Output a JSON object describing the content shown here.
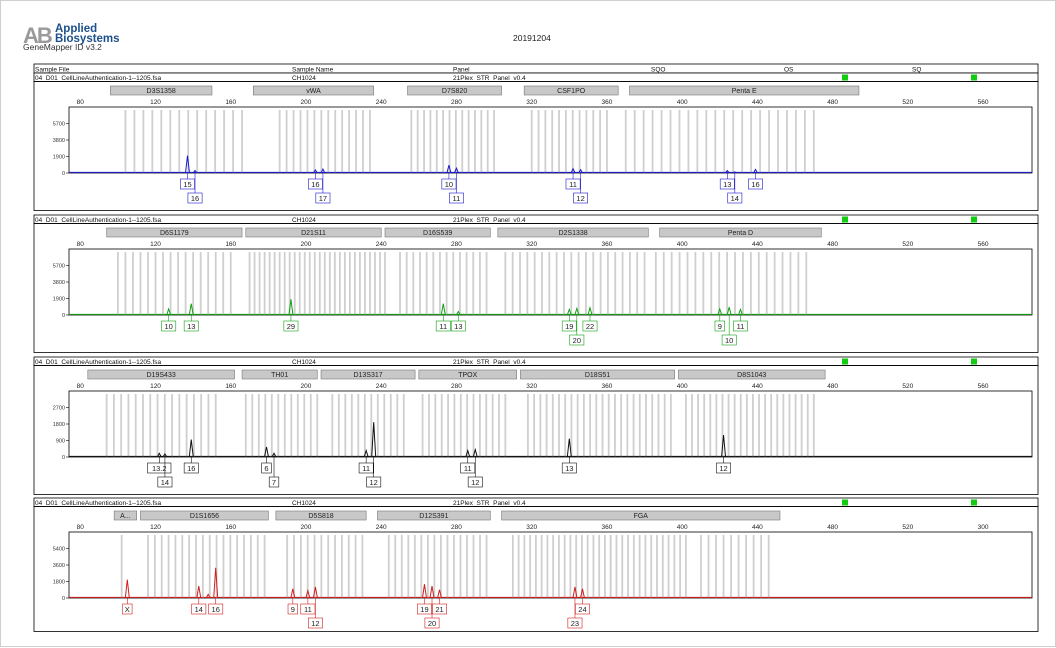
{
  "header": {
    "logo_mark": "AB",
    "logo_line1": "Applied",
    "logo_line2": "Biosystems",
    "software": "GeneMapper ID v3.2",
    "date": "20191204",
    "columns": [
      "Sample File",
      "Sample Name",
      "Panel",
      "SQO",
      "OS",
      "SQ"
    ]
  },
  "chart_data": [
    {
      "type": "line",
      "sample_file": "04_D01_CellLineAuthentication-1--1205.fsa",
      "sample_name": "CH1024",
      "panel": "21Plex_STR_Panel_v0.4",
      "color": "#1a1acc",
      "x_ticks": [
        80,
        120,
        160,
        200,
        240,
        280,
        320,
        360,
        400,
        440,
        480,
        520,
        560
      ],
      "y_ticks": [
        0,
        1900,
        3800,
        5700
      ],
      "y_tick_labels": [
        "0",
        "1900",
        "3800",
        "5700"
      ],
      "ylim": [
        0,
        7600
      ],
      "xlim": [
        74,
        586
      ],
      "markers": [
        {
          "name": "D3S1358",
          "start": 96,
          "end": 150
        },
        {
          "name": "vWA",
          "start": 172,
          "end": 236
        },
        {
          "name": "D7S820",
          "start": 254,
          "end": 304
        },
        {
          "name": "CSF1PO",
          "start": 316,
          "end": 366
        },
        {
          "name": "Penta E",
          "start": 372,
          "end": 494
        }
      ],
      "bins": [
        {
          "start": 104,
          "end": 166,
          "n": 14
        },
        {
          "start": 186,
          "end": 234,
          "n": 14
        },
        {
          "start": 256,
          "end": 300,
          "n": 14
        },
        {
          "start": 320,
          "end": 360,
          "n": 12
        },
        {
          "start": 370,
          "end": 470,
          "n": 22
        }
      ],
      "peaks": [
        {
          "x": 137,
          "h": 2000,
          "label": "15",
          "row": 0
        },
        {
          "x": 141,
          "h": 280,
          "label": "16",
          "row": 1
        },
        {
          "x": 205,
          "h": 350,
          "label": "16",
          "row": 0
        },
        {
          "x": 209,
          "h": 450,
          "label": "17",
          "row": 1
        },
        {
          "x": 276,
          "h": 900,
          "label": "10",
          "row": 0
        },
        {
          "x": 280,
          "h": 550,
          "label": "11",
          "row": 1
        },
        {
          "x": 342,
          "h": 500,
          "label": "11",
          "row": 0
        },
        {
          "x": 346,
          "h": 380,
          "label": "12",
          "row": 1
        },
        {
          "x": 424,
          "h": 280,
          "label": "13",
          "row": 0
        },
        {
          "x": 428,
          "h": 120,
          "label": "14",
          "row": 1
        },
        {
          "x": 439,
          "h": 420,
          "label": "16",
          "row": 0
        }
      ]
    },
    {
      "type": "line",
      "sample_file": "04_D01_CellLineAuthentication-1--1205.fsa",
      "sample_name": "CH1024",
      "panel": "21Plex_STR_Panel_v0.4",
      "color": "#11a011",
      "x_ticks": [
        80,
        120,
        160,
        200,
        240,
        280,
        320,
        360,
        400,
        440,
        480,
        520,
        560
      ],
      "y_ticks": [
        0,
        1900,
        3800,
        5700
      ],
      "y_tick_labels": [
        "0",
        "1900",
        "3800",
        "5700"
      ],
      "ylim": [
        0,
        7600
      ],
      "xlim": [
        74,
        586
      ],
      "markers": [
        {
          "name": "D6S1179",
          "start": 94,
          "end": 166
        },
        {
          "name": "D21S11",
          "start": 168,
          "end": 240
        },
        {
          "name": "D16S539",
          "start": 242,
          "end": 298
        },
        {
          "name": "D2S1338",
          "start": 302,
          "end": 382
        },
        {
          "name": "Penta D",
          "start": 388,
          "end": 474
        }
      ],
      "bins": [
        {
          "start": 100,
          "end": 160,
          "n": 16
        },
        {
          "start": 170,
          "end": 242,
          "n": 28
        },
        {
          "start": 250,
          "end": 296,
          "n": 14
        },
        {
          "start": 306,
          "end": 380,
          "n": 20
        },
        {
          "start": 386,
          "end": 466,
          "n": 20
        }
      ],
      "peaks": [
        {
          "x": 127,
          "h": 700,
          "label": "10",
          "row": 0
        },
        {
          "x": 139,
          "h": 1300,
          "label": "13",
          "row": 0
        },
        {
          "x": 192,
          "h": 1800,
          "label": "29",
          "row": 0
        },
        {
          "x": 273,
          "h": 1300,
          "label": "11",
          "row": 0
        },
        {
          "x": 281,
          "h": 400,
          "label": "13",
          "row": 0
        },
        {
          "x": 340,
          "h": 650,
          "label": "19",
          "row": 0
        },
        {
          "x": 344,
          "h": 750,
          "label": "20",
          "row": 1
        },
        {
          "x": 351,
          "h": 850,
          "label": "22",
          "row": 0
        },
        {
          "x": 420,
          "h": 700,
          "label": "9",
          "row": 0
        },
        {
          "x": 425,
          "h": 900,
          "label": "10",
          "row": 1
        },
        {
          "x": 431,
          "h": 650,
          "label": "11",
          "row": 0
        }
      ]
    },
    {
      "type": "line",
      "sample_file": "04_D01_CellLineAuthentication-1--1205.fsa",
      "sample_name": "CH1024",
      "panel": "21Plex_STR_Panel_v0.4",
      "color": "#111111",
      "x_ticks": [
        80,
        120,
        160,
        200,
        240,
        280,
        320,
        360,
        400,
        440,
        480,
        520,
        560
      ],
      "y_ticks": [
        0,
        900,
        1800,
        2700
      ],
      "y_tick_labels": [
        "0",
        "900",
        "1800",
        "2700"
      ],
      "ylim": [
        0,
        3600
      ],
      "xlim": [
        74,
        586
      ],
      "markers": [
        {
          "name": "D19S433",
          "start": 84,
          "end": 162
        },
        {
          "name": "TH01",
          "start": 166,
          "end": 206
        },
        {
          "name": "D13S317",
          "start": 208,
          "end": 258
        },
        {
          "name": "TPOX",
          "start": 260,
          "end": 312
        },
        {
          "name": "D18S51",
          "start": 314,
          "end": 396
        },
        {
          "name": "D8S1043",
          "start": 398,
          "end": 476
        }
      ],
      "bins": [
        {
          "start": 94,
          "end": 152,
          "n": 16
        },
        {
          "start": 168,
          "end": 206,
          "n": 12
        },
        {
          "start": 214,
          "end": 252,
          "n": 12
        },
        {
          "start": 262,
          "end": 306,
          "n": 14
        },
        {
          "start": 318,
          "end": 394,
          "n": 24
        },
        {
          "start": 402,
          "end": 470,
          "n": 22
        }
      ],
      "peaks": [
        {
          "x": 122,
          "h": 200,
          "label": "13.2",
          "row": 0
        },
        {
          "x": 125,
          "h": 160,
          "label": "14",
          "row": 1
        },
        {
          "x": 139,
          "h": 950,
          "label": "16",
          "row": 0
        },
        {
          "x": 179,
          "h": 550,
          "label": "6",
          "row": 0
        },
        {
          "x": 183,
          "h": 200,
          "label": "7",
          "row": 1
        },
        {
          "x": 232,
          "h": 350,
          "label": "11",
          "row": 0
        },
        {
          "x": 236,
          "h": 1900,
          "label": "12",
          "row": 1
        },
        {
          "x": 286,
          "h": 350,
          "label": "11",
          "row": 0
        },
        {
          "x": 290,
          "h": 400,
          "label": "12",
          "row": 1
        },
        {
          "x": 340,
          "h": 1000,
          "label": "13",
          "row": 0
        },
        {
          "x": 422,
          "h": 1200,
          "label": "12",
          "row": 0
        }
      ]
    },
    {
      "type": "line",
      "sample_file": "04_D01_CellLineAuthentication-1--1205.fsa",
      "sample_name": "CH1024",
      "panel": "21Plex_STR_Panel_v0.4",
      "color": "#d01f1f",
      "x_ticks": [
        80,
        120,
        160,
        200,
        240,
        280,
        320,
        360,
        400,
        440,
        480,
        520,
        560
      ],
      "x_tick_labels": [
        "80",
        "120",
        "160",
        "200",
        "240",
        "280",
        "320",
        "360",
        "400",
        "440",
        "480",
        "520",
        "300"
      ],
      "y_ticks": [
        0,
        1800,
        3600,
        5400
      ],
      "y_tick_labels": [
        "0",
        "1800",
        "3600",
        "5400"
      ],
      "ylim": [
        0,
        7200
      ],
      "xlim": [
        74,
        586
      ],
      "markers": [
        {
          "name": "A...",
          "start": 98,
          "end": 110
        },
        {
          "name": "D1S1656",
          "start": 112,
          "end": 180
        },
        {
          "name": "D5S818",
          "start": 184,
          "end": 232
        },
        {
          "name": "D12S391",
          "start": 238,
          "end": 298
        },
        {
          "name": "FGA",
          "start": 304,
          "end": 452
        }
      ],
      "bins": [
        {
          "start": 102,
          "end": 108,
          "n": 1
        },
        {
          "start": 116,
          "end": 178,
          "n": 18
        },
        {
          "start": 190,
          "end": 230,
          "n": 12
        },
        {
          "start": 244,
          "end": 296,
          "n": 16
        },
        {
          "start": 310,
          "end": 362,
          "n": 18
        },
        {
          "start": 362,
          "end": 402,
          "n": 14
        },
        {
          "start": 410,
          "end": 446,
          "n": 10
        }
      ],
      "peaks": [
        {
          "x": 105,
          "h": 2000,
          "label": "X",
          "row": 0
        },
        {
          "x": 143,
          "h": 1300,
          "label": "14",
          "row": 0
        },
        {
          "x": 148,
          "h": 400,
          "label": "",
          "row": 0
        },
        {
          "x": 152,
          "h": 3300,
          "label": "16",
          "row": 0
        },
        {
          "x": 193,
          "h": 1000,
          "label": "9",
          "row": 0
        },
        {
          "x": 201,
          "h": 800,
          "label": "11",
          "row": 0
        },
        {
          "x": 205,
          "h": 1200,
          "label": "12",
          "row": 1
        },
        {
          "x": 263,
          "h": 1500,
          "label": "19",
          "row": 0
        },
        {
          "x": 267,
          "h": 1300,
          "label": "20",
          "row": 1
        },
        {
          "x": 271,
          "h": 900,
          "label": "21",
          "row": 0
        },
        {
          "x": 343,
          "h": 1200,
          "label": "23",
          "row": 1
        },
        {
          "x": 347,
          "h": 1000,
          "label": "24",
          "row": 0
        }
      ]
    }
  ]
}
